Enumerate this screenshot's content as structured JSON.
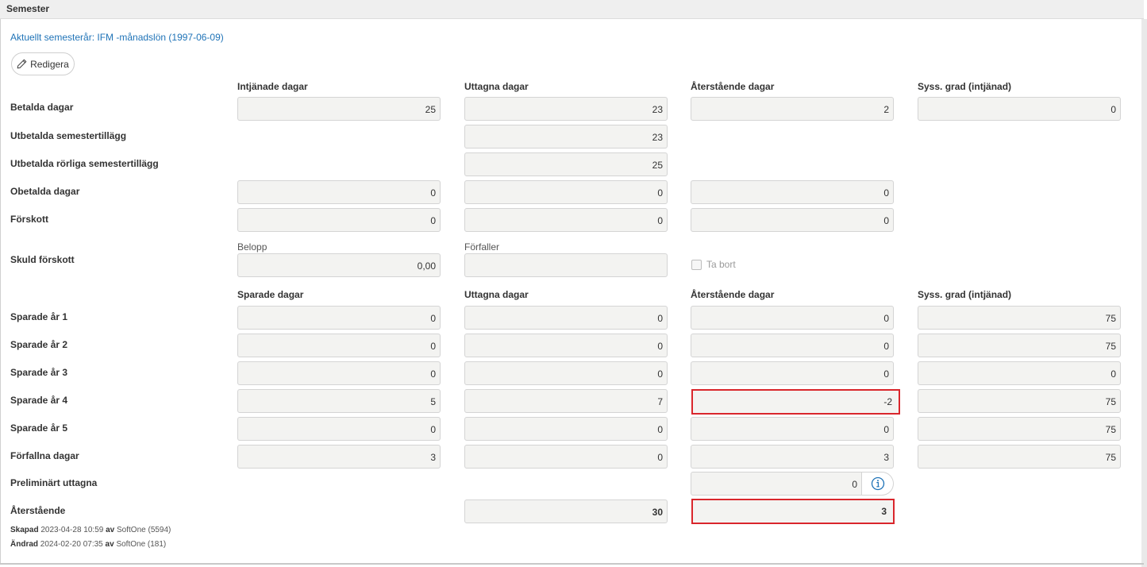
{
  "panel": {
    "title": "Semester"
  },
  "current_year_link": "Aktuellt semesterår: IFM -månadslön (1997-06-09)",
  "edit_button": {
    "label": "Redigera"
  },
  "top_columns": [
    "Intjänade dagar",
    "Uttagna dagar",
    "Återstående dagar",
    "Syss. grad (intjänad)"
  ],
  "rows_top": {
    "betalda": {
      "label": "Betalda dagar",
      "values": [
        "25",
        "23",
        "2",
        "0"
      ]
    },
    "utbetalda_tillagg": {
      "label": "Utbetalda semestertillägg",
      "value": "23"
    },
    "utbetalda_rorliga": {
      "label": "Utbetalda rörliga semestertillägg",
      "value": "25"
    },
    "obetalda": {
      "label": "Obetalda dagar",
      "values": [
        "0",
        "0",
        "0"
      ]
    },
    "forskott": {
      "label": "Förskott",
      "values": [
        "0",
        "0",
        "0"
      ]
    }
  },
  "skuld": {
    "label": "Skuld förskott",
    "belopp_label": "Belopp",
    "belopp_value": "0,00",
    "forfaller_label": "Förfaller",
    "forfaller_value": "",
    "ta_bort_label": "Ta bort"
  },
  "saved_columns": [
    "Sparade dagar",
    "Uttagna dagar",
    "Återstående dagar",
    "Syss. grad (intjänad)"
  ],
  "saved_rows": [
    {
      "label": "Sparade år 1",
      "values": [
        "0",
        "0",
        "0",
        "75"
      ]
    },
    {
      "label": "Sparade år 2",
      "values": [
        "0",
        "0",
        "0",
        "75"
      ]
    },
    {
      "label": "Sparade år 3",
      "values": [
        "0",
        "0",
        "0",
        "0"
      ]
    },
    {
      "label": "Sparade år 4",
      "values": [
        "5",
        "7",
        "-2",
        "75"
      ]
    },
    {
      "label": "Sparade år 5",
      "values": [
        "0",
        "0",
        "0",
        "75"
      ]
    },
    {
      "label": "Förfallna dagar",
      "values": [
        "3",
        "0",
        "3",
        "75"
      ]
    }
  ],
  "preliminart": {
    "label": "Preliminärt uttagna",
    "value": "0"
  },
  "aterstaende": {
    "label": "Återstående",
    "uttagna": "30",
    "aterstaende": "3"
  },
  "meta": {
    "created_label": "Skapad",
    "created_text": "2023-04-28 10:59",
    "created_by_label": "av",
    "created_by": "SoftOne (5594)",
    "changed_label": "Ändrad",
    "changed_text": "2024-02-20 07:35",
    "changed_by_label": "av",
    "changed_by": "SoftOne (181)"
  },
  "colors": {
    "link": "#1f73b7",
    "error_border": "#d9262c",
    "field_bg": "#f3f3f1"
  }
}
